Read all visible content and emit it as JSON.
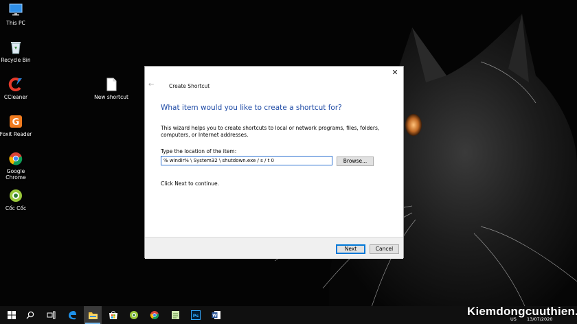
{
  "desktop": {
    "icons": [
      {
        "label": "This PC"
      },
      {
        "label": "Recycle Bin"
      },
      {
        "label": "CCleaner"
      },
      {
        "label": "Foxit Reader"
      },
      {
        "label": "Google Chrome"
      },
      {
        "label": "Cốc Cốc"
      },
      {
        "label": "New shortcut"
      }
    ]
  },
  "dialog": {
    "title": "Create Shortcut",
    "heading": "What item would you like to create a shortcut for?",
    "description": "This wizard helps you to create shortcuts to local or network programs, files, folders, computers, or Internet addresses.",
    "location_label": "Type the location of the item:",
    "location_value": "% windir% \\ System32 \\ shutdown.exe / s / t 0",
    "browse_label": "Browse...",
    "continue_text": "Click Next to continue.",
    "next_label": "Next",
    "cancel_label": "Cancel",
    "close_glyph": "✕",
    "back_glyph": "←"
  },
  "taskbar": {
    "items": [
      "windows-start",
      "search",
      "task-view",
      "edge",
      "file-explorer",
      "store",
      "coc-coc",
      "chrome",
      "notepad",
      "photoshop",
      "word"
    ],
    "active_item": "file-explorer",
    "language": "US",
    "date": "13/07/2020"
  },
  "watermark": "Kiemdongcuuthien.vn",
  "colors": {
    "heading": "#1e4aa5",
    "accent": "#0078d7",
    "taskbar": "#101010"
  }
}
